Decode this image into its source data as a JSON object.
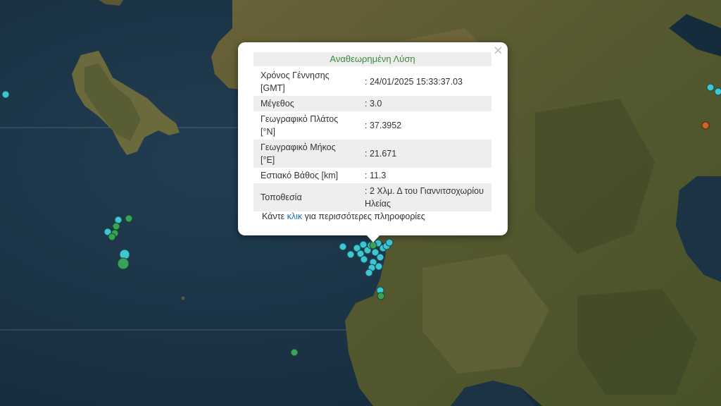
{
  "popup": {
    "title": "Αναθεωρημένη Λύση",
    "close_symbol": "×",
    "rows": [
      {
        "label": "Χρόνος Γέννησης [GMT]",
        "value": ": 24/01/2025 15:33:37.03"
      },
      {
        "label": "Μέγεθος",
        "value": ": 3.0"
      },
      {
        "label": "Γεωγραφικό Πλάτος [°N]",
        "value": ": 37.3952"
      },
      {
        "label": "Γεωγραφικό Μήκος [°E]",
        "value": ": 21.671"
      },
      {
        "label": "Εστιακό Βάθος [km]",
        "value": ": 11.3"
      },
      {
        "label": "Τοποθεσία",
        "value": ": 2 Χλμ. Δ του Γιαννιτσοχωρίου Ηλείας"
      }
    ],
    "more_prefix": "Κάντε",
    "more_link": "κλικ",
    "more_suffix": "για περισσότερες πληροφορίες"
  },
  "colors": {
    "sea": "#1b3345",
    "land": "#5b5a34",
    "marker_cyan": "#3ec6d3",
    "marker_green": "#3aa15a",
    "marker_orange": "#d0642a",
    "title_green": "#3a8a3a",
    "link_blue": "#1a6fb5"
  },
  "map": {
    "marker_types": [
      "recent-cyan",
      "older-green",
      "latest-orange"
    ]
  }
}
